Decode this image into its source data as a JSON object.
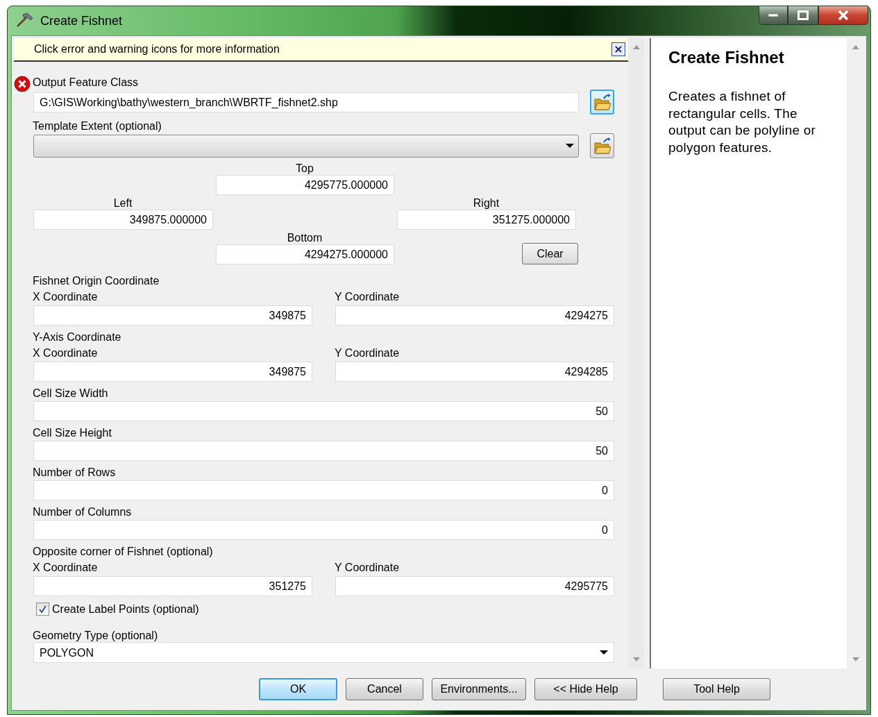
{
  "window": {
    "title": "Create Fishnet"
  },
  "message_bar": {
    "text": "Click error and warning icons for more information"
  },
  "params": [
    {
      "kind": "path",
      "error": true,
      "label": "Output Feature Class",
      "value": "G:\\GIS\\Working\\bathy\\western_branch\\WBRTF_fishnet2.shp",
      "browse": {
        "highlighted": true
      }
    },
    {
      "kind": "combo",
      "error": false,
      "label": "Template Extent (optional)",
      "browse": {
        "highlighted": false
      }
    },
    {
      "kind": "extent",
      "error": false,
      "top": {
        "label": "Top",
        "value": "4295775.000000"
      },
      "left": {
        "label": "Left",
        "value": "349875.000000"
      },
      "right": {
        "label": "Right",
        "value": "351275.000000"
      },
      "bottom": {
        "label": "Bottom",
        "value": "4294275.000000"
      },
      "clear": "Clear"
    },
    {
      "kind": "pair",
      "error": false,
      "label": "Fishnet Origin Coordinate",
      "x": {
        "label": "X Coordinate",
        "value": "349875"
      },
      "y": {
        "label": "Y Coordinate",
        "value": "4294275"
      }
    },
    {
      "kind": "pair",
      "error": false,
      "label": "Y-Axis Coordinate",
      "x": {
        "label": "X Coordinate",
        "value": "349875"
      },
      "y": {
        "label": "Y Coordinate",
        "value": "4294285"
      }
    },
    {
      "kind": "number",
      "error": false,
      "label": "Cell Size Width",
      "value": "50"
    },
    {
      "kind": "number",
      "error": false,
      "label": "Cell Size Height",
      "value": "50"
    },
    {
      "kind": "number",
      "error": false,
      "label": "Number of Rows",
      "value": "0"
    },
    {
      "kind": "number",
      "error": false,
      "label": "Number of Columns",
      "value": "0"
    },
    {
      "kind": "pair",
      "error": false,
      "label": "Opposite corner of Fishnet (optional)",
      "x": {
        "label": "X Coordinate",
        "value": "351275"
      },
      "y": {
        "label": "Y Coordinate",
        "value": "4295775"
      }
    },
    {
      "kind": "checkbox",
      "error": false,
      "label": "Create Label Points (optional)",
      "checked": true
    },
    {
      "kind": "dropdown",
      "error": false,
      "label": "Geometry Type (optional)",
      "value": "POLYGON"
    }
  ],
  "help": {
    "title": "Create Fishnet",
    "body": "Creates a fishnet of rectangular cells. The output can be polyline or polygon features.",
    "button": "Tool Help"
  },
  "buttons": [
    {
      "label": "OK",
      "default": true
    },
    {
      "label": "Cancel",
      "default": false
    },
    {
      "label": "Environments...",
      "default": false
    },
    {
      "label": "<< Hide Help",
      "default": false
    }
  ]
}
